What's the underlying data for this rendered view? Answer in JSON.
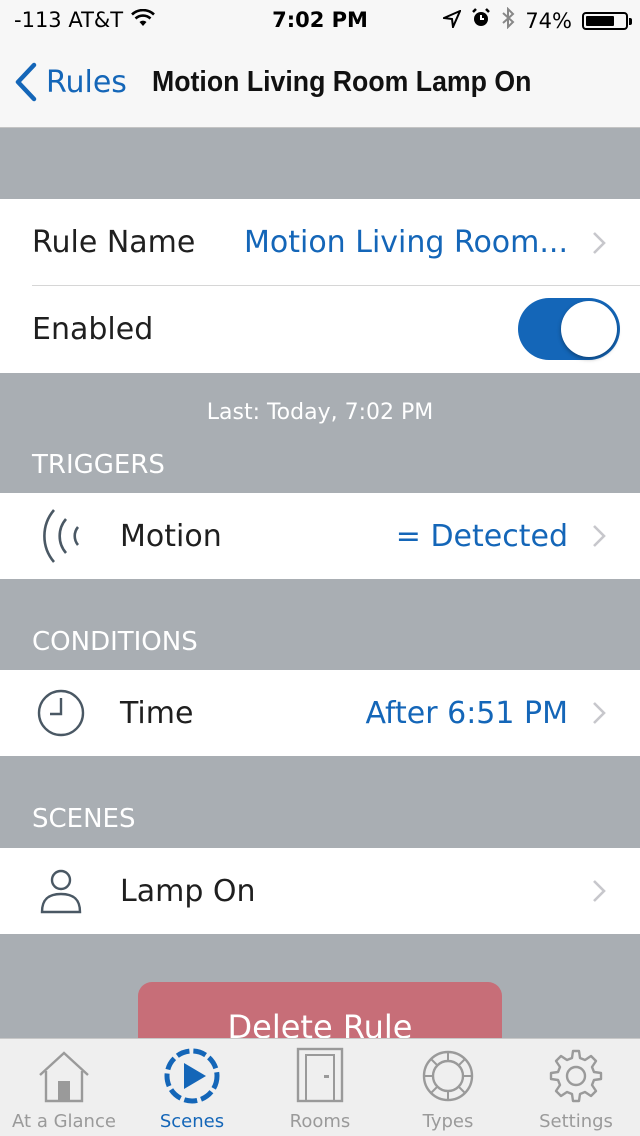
{
  "status_bar": {
    "carrier": "-113 AT&T",
    "time": "7:02 PM",
    "battery": "74%",
    "battery_level": 0.74
  },
  "nav": {
    "back_label": "Rules",
    "title": "Motion Living Room Lamp On"
  },
  "rule_name": {
    "label": "Rule Name",
    "value": "Motion Living Room..."
  },
  "enabled": {
    "label": "Enabled",
    "on": true
  },
  "last_run": "Last: Today, 7:02 PM",
  "triggers": {
    "header": "TRIGGERS",
    "items": [
      {
        "icon": "motion-waves-icon",
        "label": "Motion",
        "value": "= Detected"
      }
    ]
  },
  "conditions": {
    "header": "CONDITIONS",
    "items": [
      {
        "icon": "clock-icon",
        "label": "Time",
        "value": "After 6:51 PM"
      }
    ]
  },
  "scenes": {
    "header": "SCENES",
    "items": [
      {
        "icon": "person-icon",
        "label": "Lamp On"
      }
    ]
  },
  "delete_button": "Delete Rule",
  "tabs": [
    {
      "label": "At a Glance",
      "icon": "house-icon",
      "active": false
    },
    {
      "label": "Scenes",
      "icon": "play-circle-icon",
      "active": true
    },
    {
      "label": "Rooms",
      "icon": "door-icon",
      "active": false
    },
    {
      "label": "Types",
      "icon": "ring-icon",
      "active": false
    },
    {
      "label": "Settings",
      "icon": "gear-icon",
      "active": false
    }
  ],
  "colors": {
    "accent": "#1466b8",
    "grouped_background": "#a9aeb3",
    "delete": "#c76e78"
  }
}
